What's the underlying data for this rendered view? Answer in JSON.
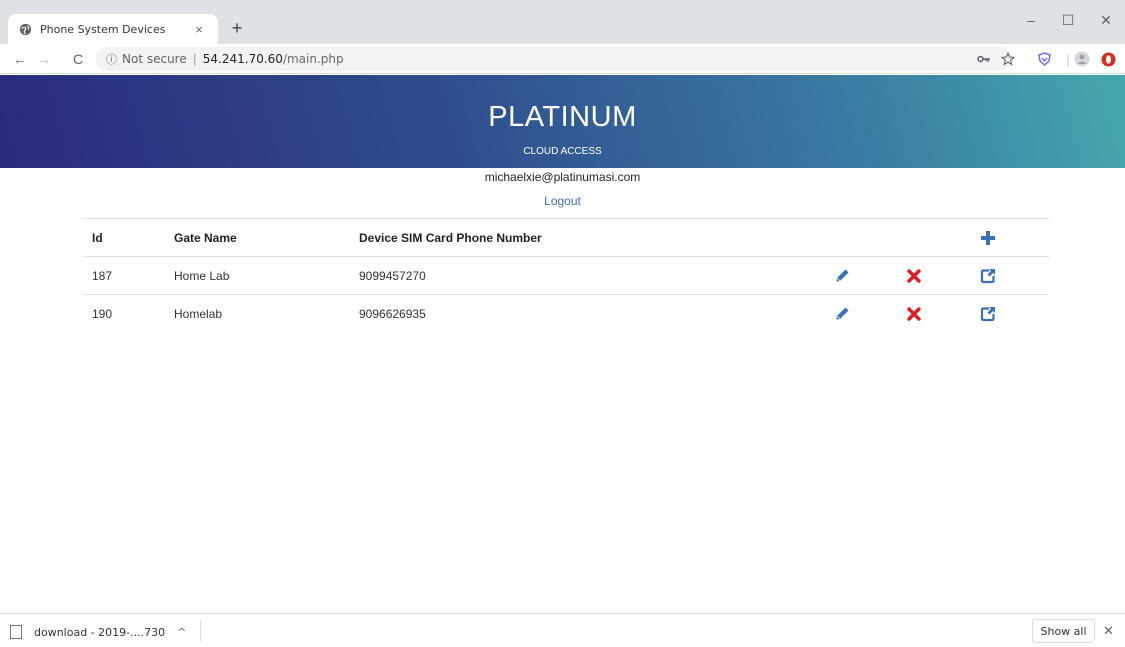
{
  "browser": {
    "tab_title": "Phone System Devices",
    "tab_close": "×",
    "new_tab": "+",
    "window_controls": {
      "minimize": "–",
      "maximize": "☐",
      "close": "✕"
    },
    "nav": {
      "back": "←",
      "forward": "→",
      "reload": "C"
    },
    "omnibox": {
      "info": "ⓘ",
      "security": "Not secure",
      "separator": "|",
      "host": "54.241.70.60",
      "path": "/main.php"
    }
  },
  "header": {
    "title": "PLATINUM",
    "subtitle": "CLOUD ACCESS"
  },
  "user": {
    "email": "michaelxie@platinumasi.com",
    "logout_label": "Logout"
  },
  "table": {
    "columns": [
      "Id",
      "Gate Name",
      "Device SIM Card Phone Number"
    ],
    "rows": [
      {
        "id": "187",
        "gate_name": "Home Lab",
        "phone": "9099457270"
      },
      {
        "id": "190",
        "gate_name": "Homelab",
        "phone": "9096626935"
      }
    ]
  },
  "downloads": {
    "file_label": "download - 2019-....730",
    "chevron": "^",
    "show_all_label": "Show all",
    "close": "✕"
  },
  "colors": {
    "accent_blue": "#3b6fb6",
    "delete_red": "#e01b24",
    "header_gradient_start": "#2b2a7c",
    "header_gradient_end": "#44a8ad"
  },
  "icons": {
    "favicon": "globe-icon",
    "edit": "pencil-icon",
    "delete": "x-icon",
    "open": "external-link-icon",
    "add": "plus-icon"
  }
}
